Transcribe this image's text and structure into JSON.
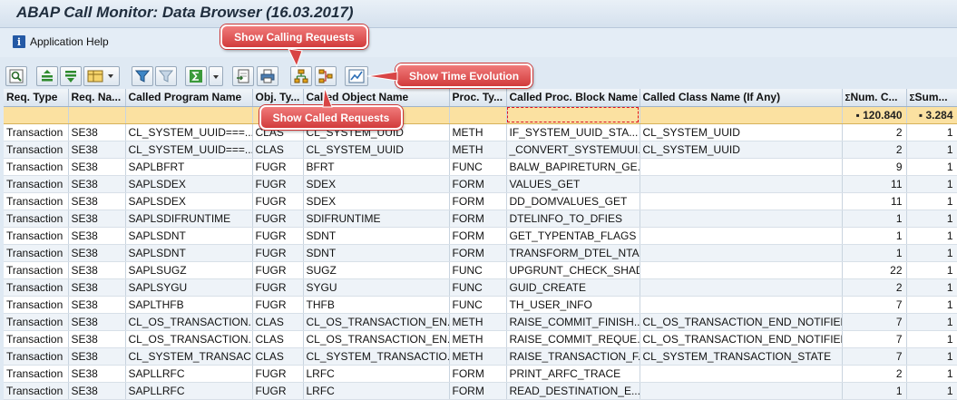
{
  "window": {
    "title": "ABAP Call Monitor: Data Browser (16.03.2017)"
  },
  "menu": {
    "application_help": "Application Help"
  },
  "toolbar": {
    "buttons": [
      "details-icon",
      "select-columns-icon",
      "filter-layout-icon",
      "layout-dropdown-icon",
      "set-filter-icon",
      "delete-filter-icon",
      "sum-icon",
      "sum-dropdown-icon",
      "export-icon",
      "print-icon",
      "show-calling-requests-icon",
      "show-called-requests-icon",
      "show-time-evolution-icon"
    ]
  },
  "annotations": {
    "calling": "Show Calling Requests",
    "called": "Show Called Requests",
    "time": "Show Time Evolution"
  },
  "grid": {
    "columns": [
      "Req. Type",
      "Req. Na...",
      "Called Program Name",
      "Obj. Ty...",
      "Called Object Name",
      "Proc. Ty...",
      "Called Proc. Block Name",
      "Called Class Name (If Any)",
      "Num. C...",
      "Sum..."
    ],
    "totals": {
      "num_calls": "120.840",
      "sum": "3.284"
    },
    "rows": [
      [
        "Transaction",
        "SE38",
        "CL_SYSTEM_UUID===...",
        "CLAS",
        "CL_SYSTEM_UUID",
        "METH",
        "IF_SYSTEM_UUID_STA...",
        "CL_SYSTEM_UUID",
        "2",
        "1"
      ],
      [
        "Transaction",
        "SE38",
        "CL_SYSTEM_UUID===...",
        "CLAS",
        "CL_SYSTEM_UUID",
        "METH",
        "_CONVERT_SYSTEMUUI...",
        "CL_SYSTEM_UUID",
        "2",
        "1"
      ],
      [
        "Transaction",
        "SE38",
        "SAPLBFRT",
        "FUGR",
        "BFRT",
        "FUNC",
        "BALW_BAPIRETURN_GE...",
        "",
        "9",
        "1"
      ],
      [
        "Transaction",
        "SE38",
        "SAPLSDEX",
        "FUGR",
        "SDEX",
        "FORM",
        "VALUES_GET",
        "",
        "11",
        "1"
      ],
      [
        "Transaction",
        "SE38",
        "SAPLSDEX",
        "FUGR",
        "SDEX",
        "FORM",
        "DD_DOMVALUES_GET",
        "",
        "11",
        "1"
      ],
      [
        "Transaction",
        "SE38",
        "SAPLSDIFRUNTIME",
        "FUGR",
        "SDIFRUNTIME",
        "FORM",
        "DTELINFO_TO_DFIES",
        "",
        "1",
        "1"
      ],
      [
        "Transaction",
        "SE38",
        "SAPLSDNT",
        "FUGR",
        "SDNT",
        "FORM",
        "GET_TYPENTAB_FLAGS",
        "",
        "1",
        "1"
      ],
      [
        "Transaction",
        "SE38",
        "SAPLSDNT",
        "FUGR",
        "SDNT",
        "FORM",
        "TRANSFORM_DTEL_NTAB",
        "",
        "1",
        "1"
      ],
      [
        "Transaction",
        "SE38",
        "SAPLSUGZ",
        "FUGR",
        "SUGZ",
        "FUNC",
        "UPGRUNT_CHECK_SHAD...",
        "",
        "22",
        "1"
      ],
      [
        "Transaction",
        "SE38",
        "SAPLSYGU",
        "FUGR",
        "SYGU",
        "FUNC",
        "GUID_CREATE",
        "",
        "2",
        "1"
      ],
      [
        "Transaction",
        "SE38",
        "SAPLTHFB",
        "FUGR",
        "THFB",
        "FUNC",
        "TH_USER_INFO",
        "",
        "7",
        "1"
      ],
      [
        "Transaction",
        "SE38",
        "CL_OS_TRANSACTION...",
        "CLAS",
        "CL_OS_TRANSACTION_EN...",
        "METH",
        "RAISE_COMMIT_FINISH...",
        "CL_OS_TRANSACTION_END_NOTIFIER",
        "7",
        "1"
      ],
      [
        "Transaction",
        "SE38",
        "CL_OS_TRANSACTION...",
        "CLAS",
        "CL_OS_TRANSACTION_EN...",
        "METH",
        "RAISE_COMMIT_REQUE...",
        "CL_OS_TRANSACTION_END_NOTIFIER",
        "7",
        "1"
      ],
      [
        "Transaction",
        "SE38",
        "CL_SYSTEM_TRANSAC...",
        "CLAS",
        "CL_SYSTEM_TRANSACTIO...",
        "METH",
        "RAISE_TRANSACTION_F...",
        "CL_SYSTEM_TRANSACTION_STATE",
        "7",
        "1"
      ],
      [
        "Transaction",
        "SE38",
        "SAPLLRFC",
        "FUGR",
        "LRFC",
        "FORM",
        "PRINT_ARFC_TRACE",
        "",
        "2",
        "1"
      ],
      [
        "Transaction",
        "SE38",
        "SAPLLRFC",
        "FUGR",
        "LRFC",
        "FORM",
        "READ_DESTINATION_E...",
        "",
        "1",
        "1"
      ]
    ]
  }
}
